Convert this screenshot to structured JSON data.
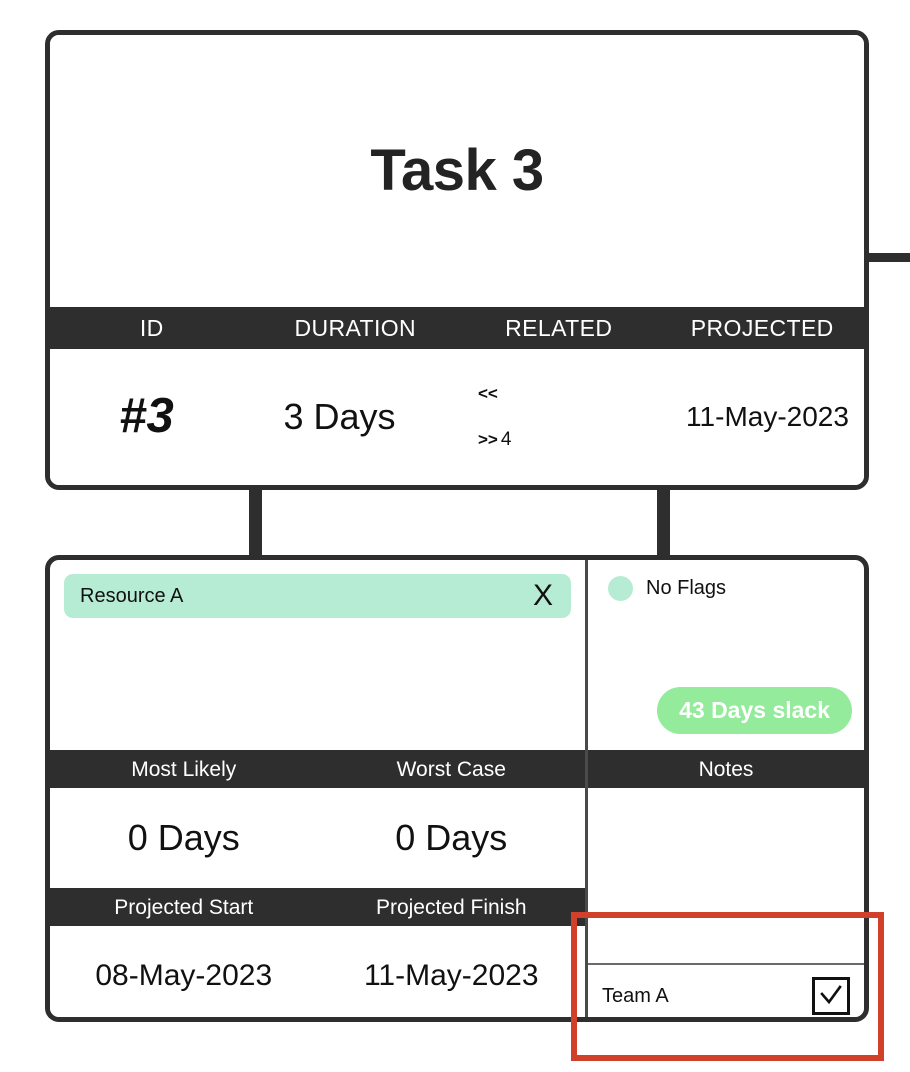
{
  "task_card": {
    "title": "Task 3",
    "columns": [
      "ID",
      "DURATION",
      "RELATED",
      "PROJECTED"
    ],
    "values": {
      "id": "#3",
      "duration": "3 Days",
      "projected": "11-May-2023"
    },
    "related": {
      "predecessors_symbol": "<<",
      "predecessors_count": "",
      "successors_symbol": ">>",
      "successors_count": "4"
    }
  },
  "detail_card": {
    "resources": [
      {
        "name": "Resource A",
        "remove_label": "X"
      }
    ],
    "flags": {
      "label": "No Flags",
      "dot_color": "#b6ecd4"
    },
    "slack": {
      "label": "43 Days slack",
      "color": "#93eb9b"
    },
    "estimate_headers": [
      "Most Likely",
      "Worst Case"
    ],
    "estimate_values": [
      "0 Days",
      "0 Days"
    ],
    "schedule_headers": [
      "Projected Start",
      "Projected Finish"
    ],
    "schedule_values": [
      "08-May-2023",
      "11-May-2023"
    ],
    "notes": {
      "header": "Notes",
      "items": [
        {
          "label": "Team A",
          "checked": true
        }
      ]
    }
  },
  "annotation": {
    "color": "#d1402a"
  },
  "theme": {
    "header_bar": "#2e2e2e",
    "border": "#2e2e2e",
    "resource_chip": "#b6ecd4",
    "slack_pill": "#93eb9b"
  }
}
